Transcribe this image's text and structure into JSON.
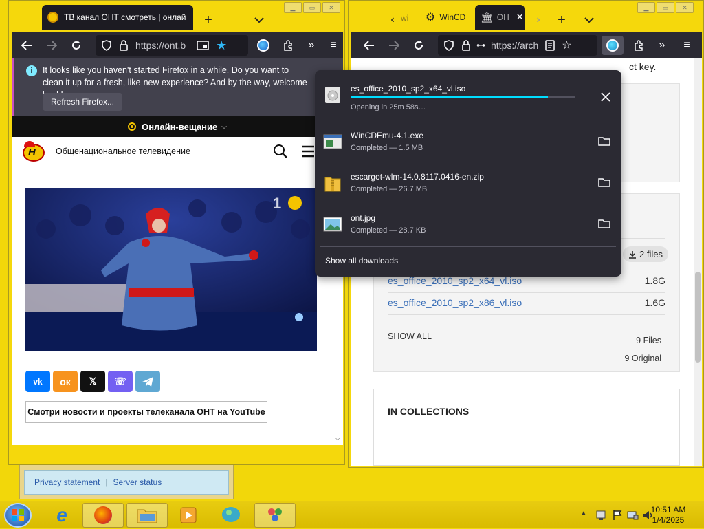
{
  "left_window": {
    "tab_title": "ТВ канал ОНТ смотреть | онлай",
    "url": "https://ont.b",
    "notice": {
      "text": "It looks like you haven't started Firefox in a while. Do you want to clean it up for a fresh, like-new experience? And by the way, welcome back!",
      "button": "Refresh Firefox..."
    },
    "online_label": "Онлайн-вещание",
    "site_title": "Общенациональное телевидение",
    "share_buttons": [
      "vk",
      "ok",
      "x",
      "viber",
      "telegram"
    ],
    "youtube_button": "Смотри новости и проекты телеканала ОНТ на YouTube"
  },
  "background_window": {
    "links": [
      "Privacy statement",
      "Server status"
    ]
  },
  "right_window": {
    "tabs": [
      "wi",
      "WinCD",
      "OH"
    ],
    "url": "https://arch",
    "partial_text": "ct key.",
    "files_badge": "2 files",
    "files": [
      {
        "name": "es_office_2010_sp2_x64_vl.iso",
        "size": "1.8G"
      },
      {
        "name": "es_office_2010_sp2_x86_vl.iso",
        "size": "1.6G"
      }
    ],
    "show_all": "SHOW ALL",
    "files_count": "9 Files",
    "original_count": "9 Original",
    "collections_title": "IN COLLECTIONS"
  },
  "downloads": {
    "items": [
      {
        "name": "es_office_2010_sp2_x64_vl.iso",
        "status": "Opening in 25m 58s…",
        "progress": 0.88,
        "icon": "disc-icon"
      },
      {
        "name": "WinCDEmu-4.1.exe",
        "status": "Completed — 1.5 MB",
        "icon": "installer-icon"
      },
      {
        "name": "escargot-wlm-14.0.8117.0416-en.zip",
        "status": "Completed — 26.7 MB",
        "icon": "zip-icon"
      },
      {
        "name": "ont.jpg",
        "status": "Completed — 28.7 KB",
        "icon": "image-icon"
      }
    ],
    "show_all": "Show all downloads"
  },
  "taskbar": {
    "time": "10:51 AM",
    "date": "1/4/2025"
  },
  "colors": {
    "desktop": "#f2d70a",
    "firefox_dark": "#2b2a33",
    "progress": "#00ddff",
    "link": "#3a6fb8"
  }
}
